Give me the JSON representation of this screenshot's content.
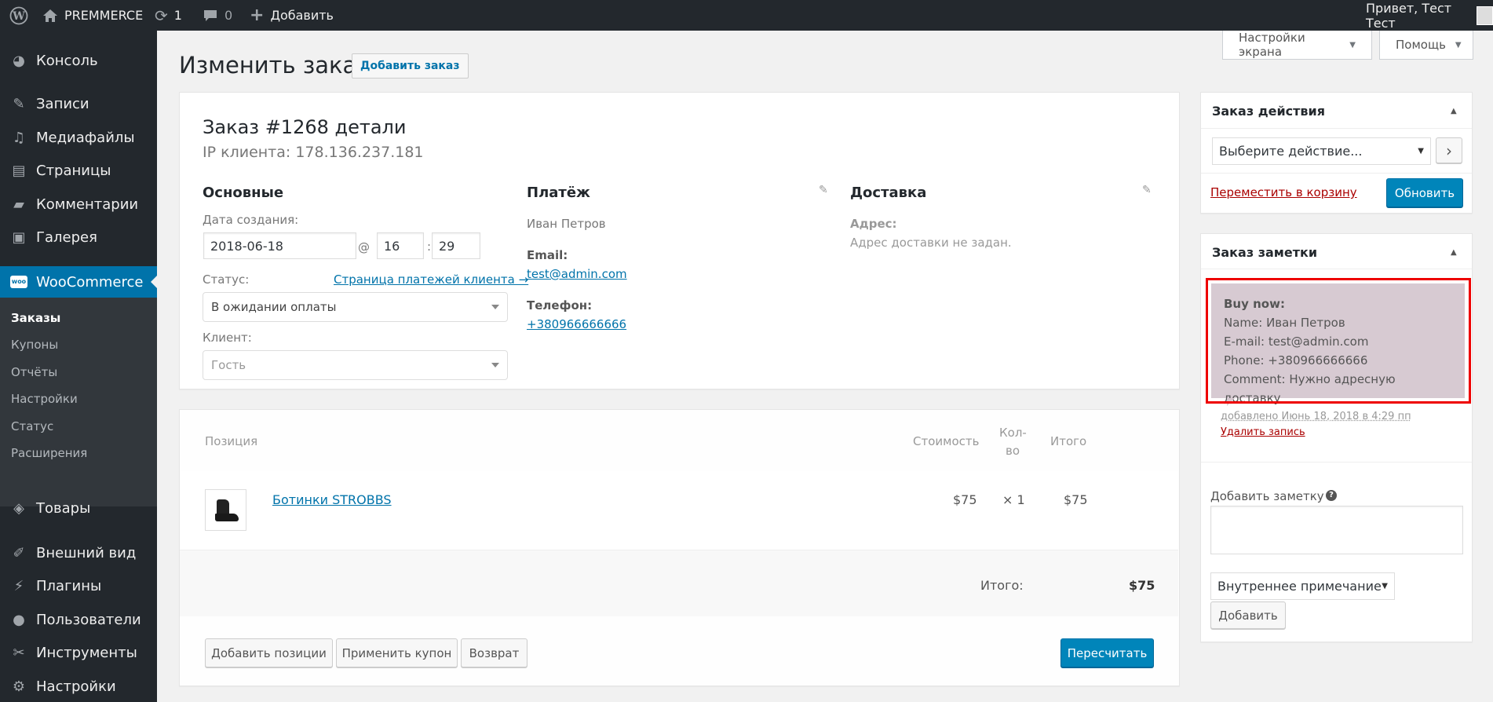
{
  "admin_bar": {
    "site_name": "PREMMERCE",
    "updates_count": "1",
    "comments_count": "0",
    "add_new": "Добавить",
    "greeting": "Привет, Тест Тест"
  },
  "menu": {
    "items": [
      {
        "label": "Консоль",
        "icon": "dashboard-icon"
      },
      {
        "label": "Записи",
        "icon": "pin-icon"
      },
      {
        "label": "Медиафайлы",
        "icon": "media-icon"
      },
      {
        "label": "Страницы",
        "icon": "pages-icon"
      },
      {
        "label": "Комментарии",
        "icon": "comment-icon"
      },
      {
        "label": "Галерея",
        "icon": "gallery-icon"
      },
      {
        "label": "WooCommerce",
        "icon": "woo-icon"
      },
      {
        "label": "Товары",
        "icon": "box-icon"
      },
      {
        "label": "Внешний вид",
        "icon": "brush-icon"
      },
      {
        "label": "Плагины",
        "icon": "plugin-icon"
      },
      {
        "label": "Пользователи",
        "icon": "users-icon"
      },
      {
        "label": "Инструменты",
        "icon": "wrench-icon"
      },
      {
        "label": "Настройки",
        "icon": "settings-icon"
      }
    ],
    "submenu": [
      "Заказы",
      "Купоны",
      "Отчёты",
      "Настройки",
      "Статус",
      "Расширения"
    ]
  },
  "screen_options": "Настройки экрана",
  "help": "Помощь",
  "page": {
    "title": "Изменить заказ",
    "add_order": "Добавить заказ"
  },
  "order": {
    "heading": "Заказ #1268 детали",
    "ip": "IP клиента: 178.136.237.181",
    "general": {
      "title": "Основные",
      "date_label": "Дата создания:",
      "date": "2018-06-18",
      "at": "@",
      "hour": "16",
      "colon": ":",
      "minute": "29",
      "status_label": "Статус:",
      "payments_link": "Страница платежей клиента →",
      "status": "В ожидании оплаты",
      "client_label": "Клиент:",
      "client": "Гость"
    },
    "billing": {
      "title": "Платёж",
      "name": "Иван Петров",
      "email_label": "Email:",
      "email": "test@admin.com",
      "phone_label": "Телефон:",
      "phone": "+380966666666"
    },
    "shipping": {
      "title": "Доставка",
      "address_label": "Адрес:",
      "address": "Адрес доставки не задан."
    }
  },
  "items": {
    "headers": {
      "item": "Позиция",
      "cost": "Стоимость",
      "qty_1": "Кол-",
      "qty_2": "во",
      "total": "Итого"
    },
    "rows": [
      {
        "name": "Ботинки STROBBS",
        "cost": "$75",
        "qty": "× 1",
        "total": "$75"
      }
    ],
    "totals_label": "Итого:",
    "totals_value": "$75",
    "buttons": {
      "add_items": "Добавить позиции",
      "apply_coupon": "Применить купон",
      "refund": "Возврат",
      "recalculate": "Пересчитать"
    }
  },
  "actions_box": {
    "title": "Заказ действия",
    "select": "Выберите действие...",
    "go": "›",
    "trash": "Переместить в корзину",
    "update": "Обновить"
  },
  "notes_box": {
    "title": "Заказ заметки",
    "note": {
      "line1": "Buy now:",
      "line2": "Name: Иван Петров",
      "line3": "E-mail: test@admin.com",
      "line4": "Phone: +380966666666",
      "line5": "Comment: Нужно адресную доставку"
    },
    "meta": "добавлено Июнь 18, 2018 в 4:29 пп",
    "delete": "Удалить запись",
    "add_label": "Добавить заметку",
    "help": "?",
    "note_type": "Внутреннее примечание",
    "add_button": "Добавить"
  },
  "colors": {
    "accent": "#0073aa",
    "primary_button": "#0085ba",
    "note_bg": "#d7cad2",
    "highlight": "#e00000"
  }
}
